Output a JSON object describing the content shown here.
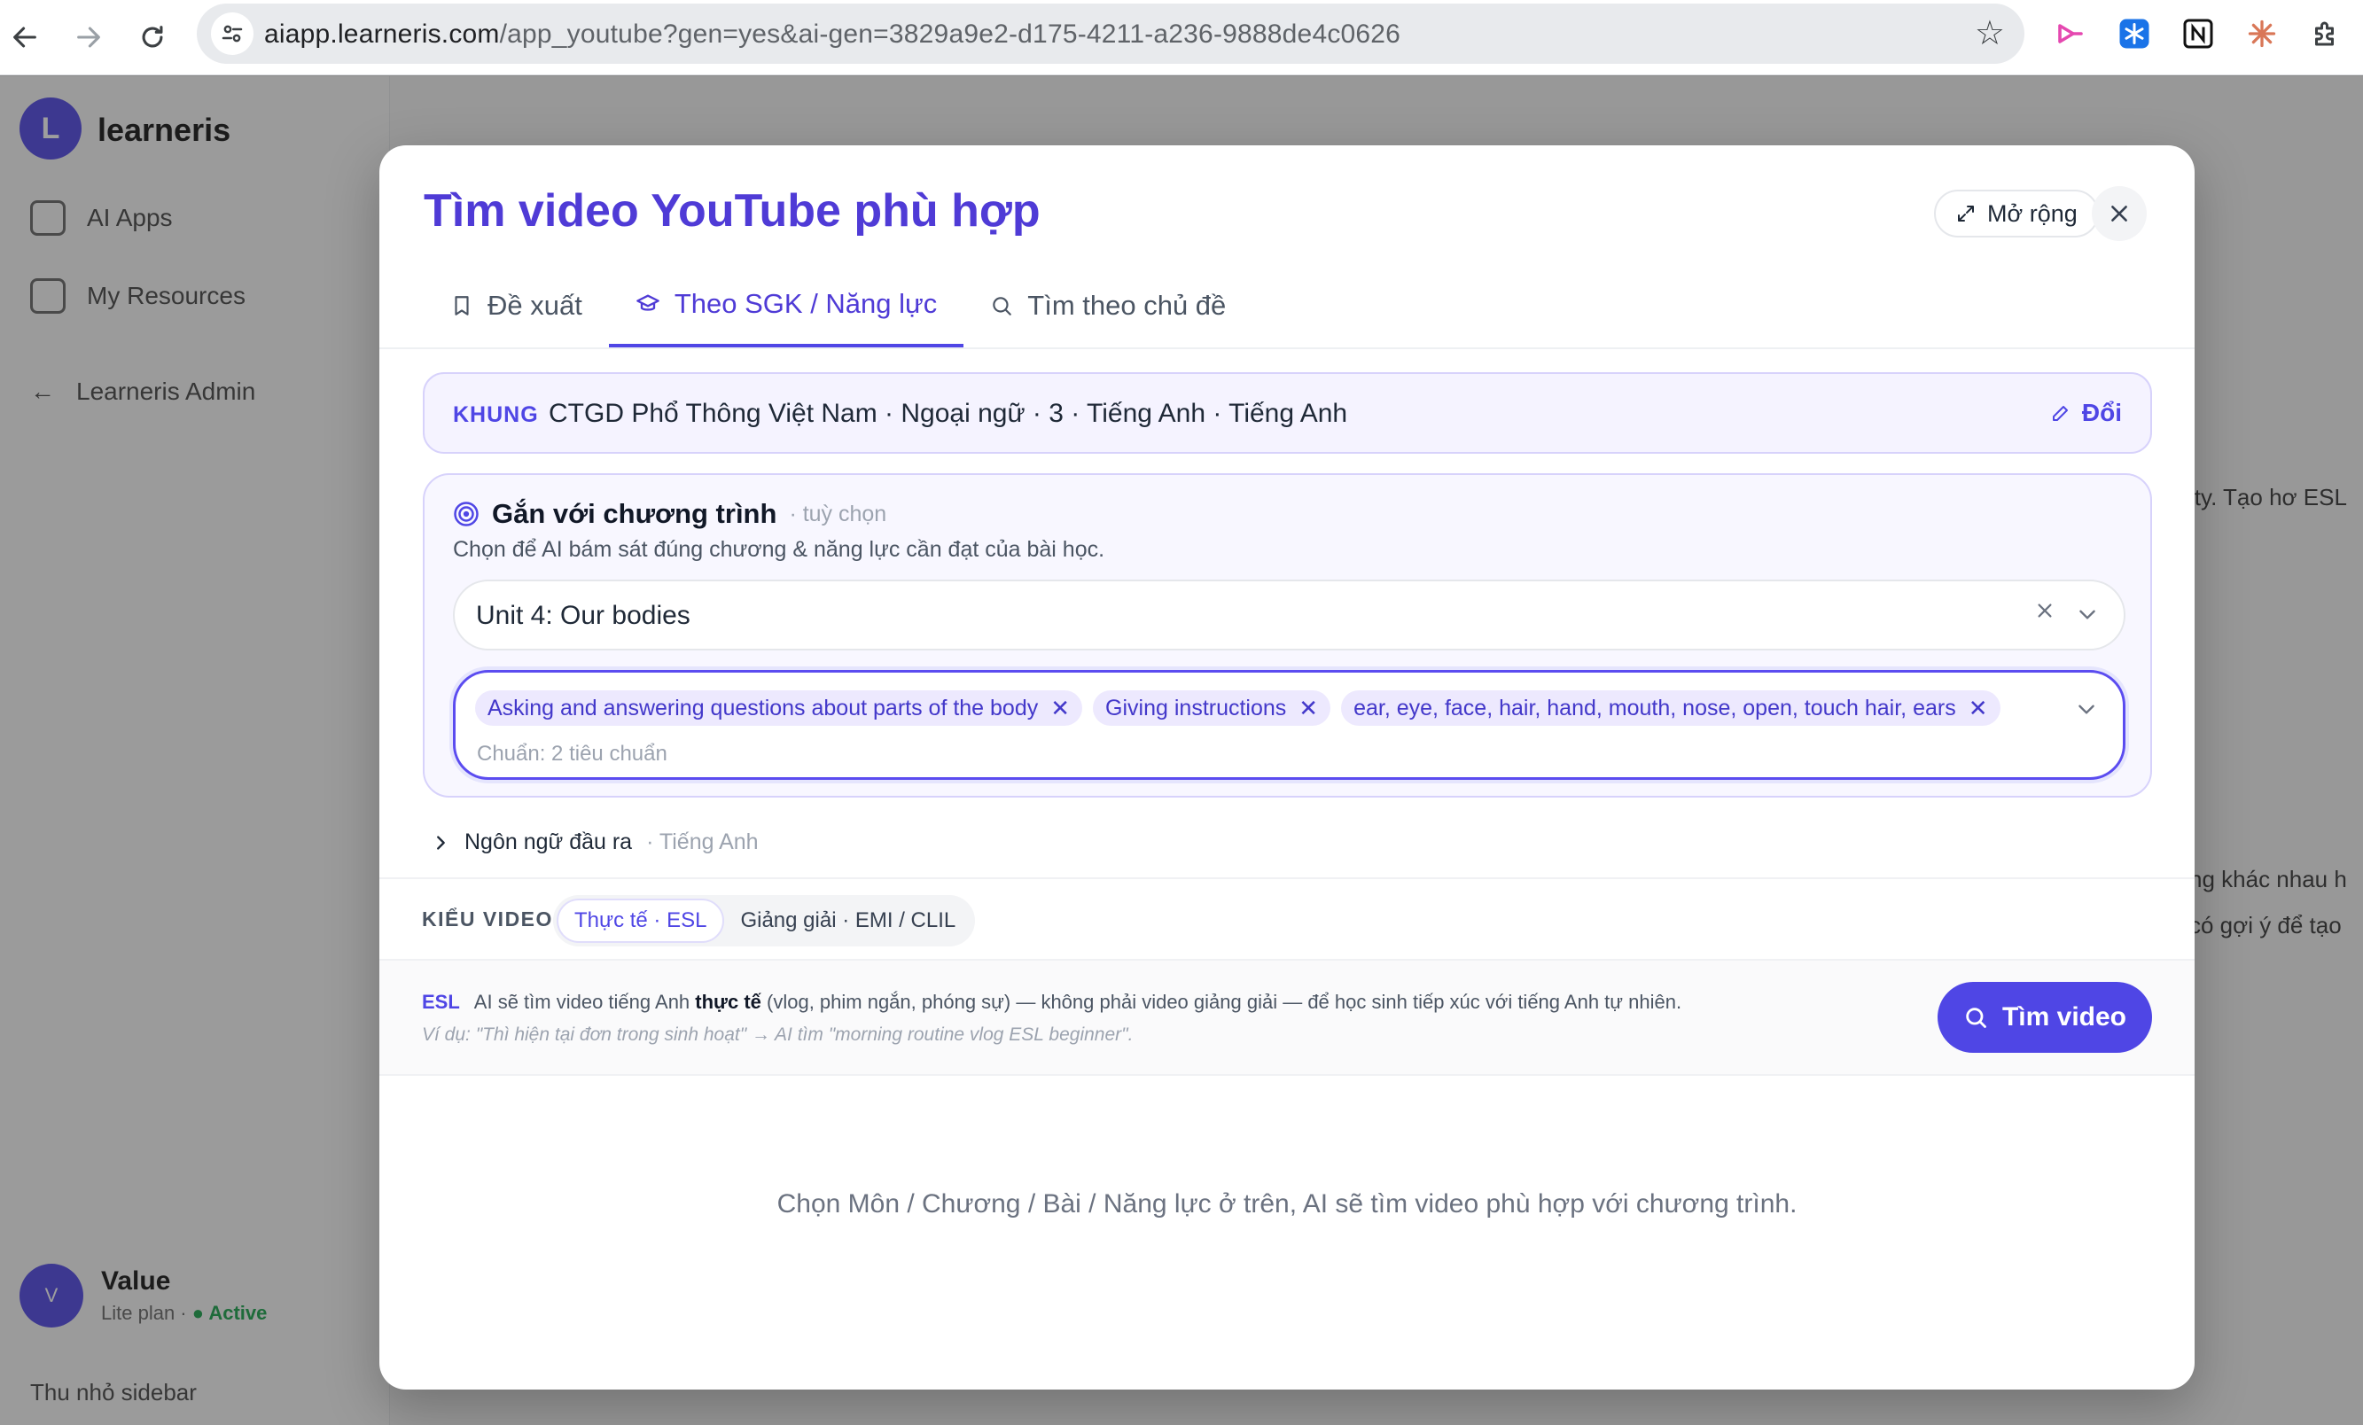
{
  "browser": {
    "url_host": "aiapp.learneris.com",
    "url_rest": "/app_youtube?gen=yes&ai-gen=3829a9e2-d175-4211-a236-9888de4c0626"
  },
  "background": {
    "brand": "learneris",
    "logo_letter": "L",
    "nav": [
      "AI Apps",
      "My Resources",
      "Learneris Admin"
    ],
    "user_name": "Value",
    "user_status_prefix": "Lite plan ·",
    "user_status_badge": "● Active",
    "bottom_item": "Thu nhỏ sidebar",
    "side_text": "ity. Tạo hơ ESL",
    "side_text2": "ng khác nhau h\ncó gợi ý để tạo"
  },
  "modal": {
    "title": "Tìm video YouTube phù hợp",
    "expand_label": "Mở rộng",
    "tabs": [
      {
        "label": "Đề xuất",
        "icon": "bookmark-icon"
      },
      {
        "label": "Theo SGK / Năng lực",
        "icon": "graduation-cap-icon"
      },
      {
        "label": "Tìm theo chủ đề",
        "icon": "search-icon"
      }
    ],
    "framework": {
      "label": "KHUNG",
      "value": "CTGD Phổ Thông Việt Nam · Ngoại ngữ · 3 · Tiếng Anh · Tiếng Anh",
      "edit_label": "Đổi"
    },
    "program": {
      "title": "Gắn với chương trình",
      "optional": "· tuỳ chọn",
      "description": "Chọn để AI bám sát đúng chương & năng lực cần đạt của bài học.",
      "unit_value": "Unit 4: Our bodies",
      "tags": [
        "Asking and answering questions about parts of the body",
        "Giving instructions",
        "ear, eye, face, hair, hand, mouth, nose, open, touch hair, ears"
      ],
      "standards_count": "Chuẩn: 2 tiêu chuẩn"
    },
    "output_language": {
      "label": "Ngôn ngữ đầu ra",
      "value": "· Tiếng Anh"
    },
    "video_type": {
      "label": "KIỂU VIDEO",
      "options": [
        "Thực tế · ESL",
        "Giảng giải · EMI / CLIL"
      ],
      "selected": "Thực tế · ESL"
    },
    "esl": {
      "tag": "ESL",
      "text_before": "AI sẽ tìm video tiếng Anh ",
      "text_strong": "thực tế",
      "text_after": " (vlog, phim ngắn, phóng sự) — không phải video giảng giải — để học sinh tiếp xúc với tiếng Anh tự nhiên.",
      "example": "Ví dụ: \"Thì hiện tại đơn trong sinh hoạt\" → AI tìm \"morning routine vlog ESL beginner\"."
    },
    "search_button": "Tìm video",
    "empty_state": "Chọn Môn / Chương / Bài / Năng lực ở trên, AI sẽ tìm video phù hợp với chương trình."
  },
  "colors": {
    "accent": "#4f46e5",
    "title": "#4f3bd6",
    "tag_bg": "#ede9fe"
  }
}
